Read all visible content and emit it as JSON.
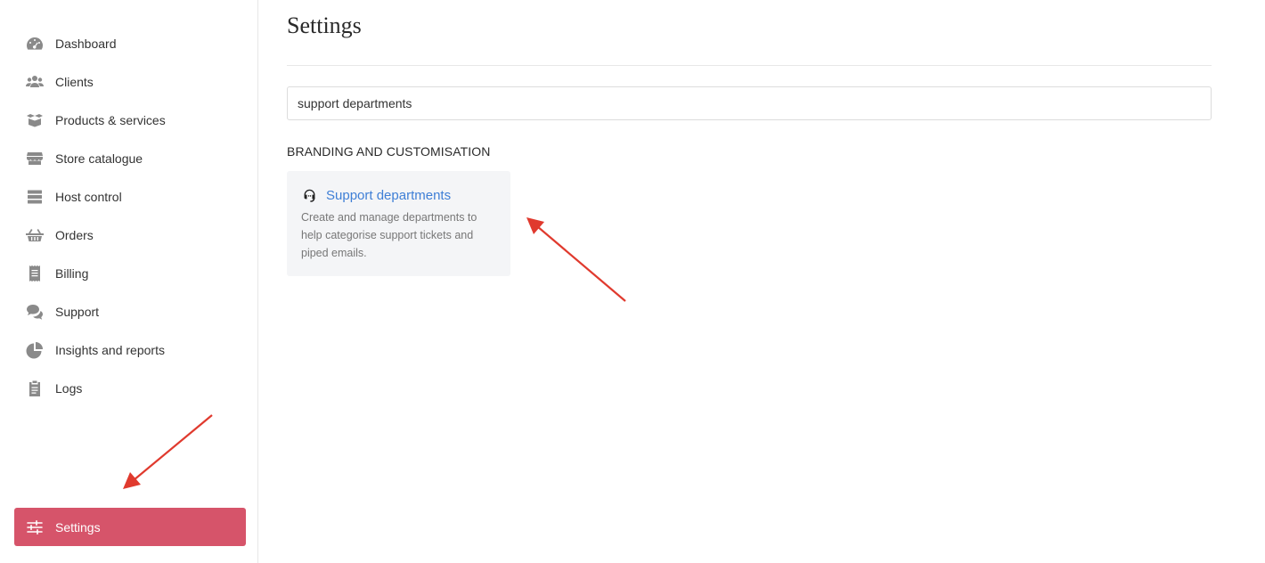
{
  "sidebar": {
    "items": [
      {
        "label": "Dashboard",
        "icon": "dashboard-icon"
      },
      {
        "label": "Clients",
        "icon": "users-icon"
      },
      {
        "label": "Products & services",
        "icon": "box-icon"
      },
      {
        "label": "Store catalogue",
        "icon": "store-icon"
      },
      {
        "label": "Host control",
        "icon": "server-icon"
      },
      {
        "label": "Orders",
        "icon": "basket-icon"
      },
      {
        "label": "Billing",
        "icon": "receipt-icon"
      },
      {
        "label": "Support",
        "icon": "chat-icon"
      },
      {
        "label": "Insights and reports",
        "icon": "pie-chart-icon"
      },
      {
        "label": "Logs",
        "icon": "clipboard-icon"
      }
    ],
    "settings": {
      "label": "Settings",
      "icon": "sliders-icon"
    }
  },
  "main": {
    "title": "Settings",
    "search": {
      "value": "support departments",
      "placeholder": ""
    },
    "section_heading": "BRANDING AND CUSTOMISATION",
    "card": {
      "title": "Support departments",
      "icon": "headset-icon",
      "description": "Create and manage departments to help categorise support tickets and piped emails."
    }
  },
  "colors": {
    "accent": "#d6546a",
    "link": "#3f7fd6",
    "annotation": "#e03a2e"
  }
}
